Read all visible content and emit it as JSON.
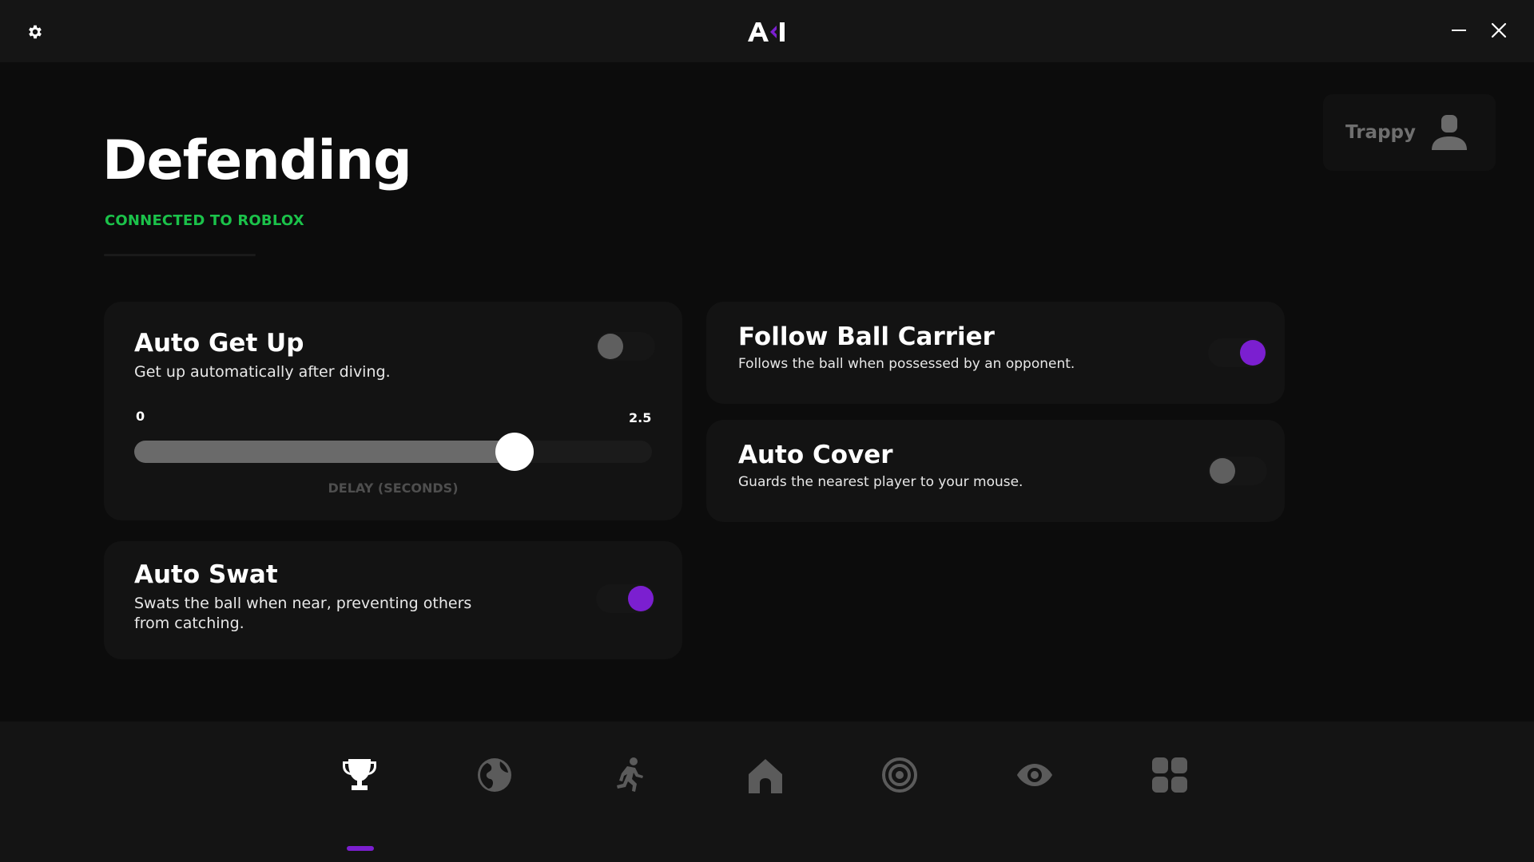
{
  "app": {
    "logo_text": "A<I"
  },
  "user": {
    "name": "Trappy"
  },
  "page": {
    "title": "Defending",
    "status": "CONNECTED TO ROBLOX"
  },
  "colors": {
    "accent": "#7b1fd0",
    "status_green": "#1bc24a",
    "background": "#0c0c0c",
    "card": "#131313"
  },
  "cards": {
    "auto_get_up": {
      "title": "Auto Get Up",
      "description": "Get up automatically after diving.",
      "enabled": false,
      "slider": {
        "min_label": "0",
        "max_label": "2.5",
        "caption": "DELAY (SECONDS)",
        "min": 0,
        "max": 2.5,
        "value": 2.0
      }
    },
    "auto_swat": {
      "title": "Auto Swat",
      "description_line1": "Swats the ball when near, preventing others",
      "description_line2": "from catching.",
      "enabled": true
    },
    "follow_ball_carrier": {
      "title": "Follow Ball Carrier",
      "description": "Follows the ball when possessed by an opponent.",
      "enabled": true
    },
    "auto_cover": {
      "title": "Auto Cover",
      "description": "Guards the nearest player to your mouse.",
      "enabled": false
    }
  },
  "nav": {
    "items": [
      {
        "icon": "trophy-icon",
        "active": true
      },
      {
        "icon": "globe-icon",
        "active": false
      },
      {
        "icon": "running-icon",
        "active": false
      },
      {
        "icon": "home-icon",
        "active": false
      },
      {
        "icon": "target-icon",
        "active": false
      },
      {
        "icon": "eye-icon",
        "active": false
      },
      {
        "icon": "grid-icon",
        "active": false
      }
    ]
  }
}
